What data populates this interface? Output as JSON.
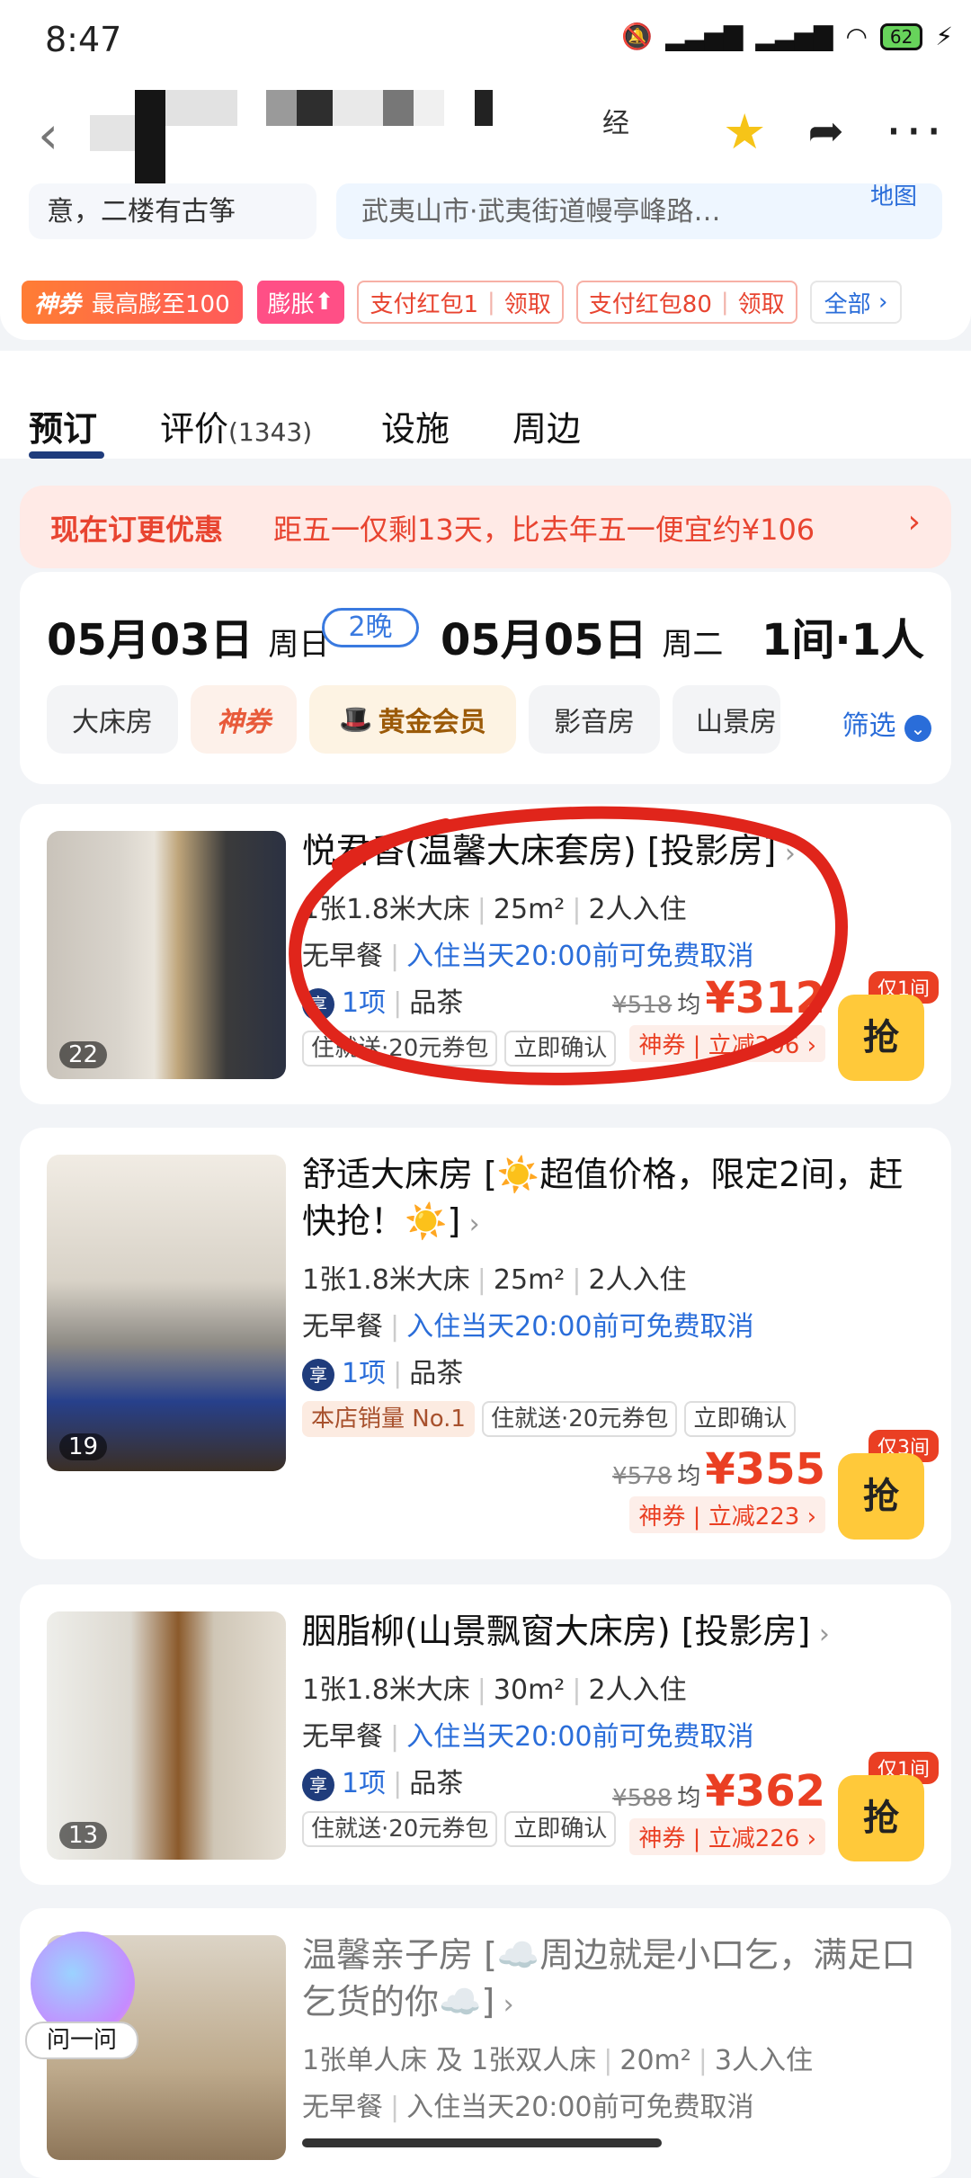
{
  "status_bar": {
    "time": "8:47",
    "battery": "62"
  },
  "header": {
    "title_visible_tail": "经"
  },
  "info": {
    "tip_text": "意，二楼有古筝",
    "address": "武夷山市·武夷街道幔亭峰路…",
    "map_label": "地图"
  },
  "coupons": {
    "god_tag": "神券",
    "god_text": "最高膨至100",
    "swell": "膨胀",
    "pay1_text": "支付红包1",
    "pay1_action": "领取",
    "pay2_text": "支付红包80",
    "pay2_action": "领取",
    "all": "全部"
  },
  "tabs": [
    {
      "label": "预订"
    },
    {
      "label": "评价",
      "count": "(1343)"
    },
    {
      "label": "设施"
    },
    {
      "label": "周边"
    }
  ],
  "promo": {
    "left": "现在订更优惠",
    "right": "距五一仅剩13天，比去年五一便宜约¥106"
  },
  "search": {
    "checkin_date": "05月03日",
    "checkin_weekday": "周日",
    "nights": "2晚",
    "checkout_date": "05月05日",
    "checkout_weekday": "周二",
    "guests": "1间·1人",
    "filters": [
      "大床房",
      "神券",
      "黄金会员",
      "影音房",
      "山景房"
    ],
    "filter_button": "筛选"
  },
  "rooms": [
    {
      "title": "悦君香(温馨大床套房) [投影房]",
      "bed": "1张1.8米大床",
      "area": "25m²",
      "occupancy": "2人入住",
      "breakfast": "无早餐",
      "cancel": "入住当天20:00前可免费取消",
      "perk_count": "1项",
      "perk_item": "品茶",
      "tags": [
        "住就送·20元券包",
        "立即确认"
      ],
      "old_price": "¥518",
      "avg_label": "均",
      "price": "¥312",
      "coupon_label": "神券",
      "discount": "立减206",
      "remaining": "仅1间",
      "grab": "抢",
      "image_count": "22"
    },
    {
      "title": "舒适大床房 [☀️超值价格，限定2间，赶快抢！☀️]",
      "bed": "1张1.8米大床",
      "area": "25m²",
      "occupancy": "2人入住",
      "breakfast": "无早餐",
      "cancel": "入住当天20:00前可免费取消",
      "perk_count": "1项",
      "perk_item": "品茶",
      "sales_tag": "本店销量 No.1",
      "tags": [
        "住就送·20元券包",
        "立即确认"
      ],
      "old_price": "¥578",
      "avg_label": "均",
      "price": "¥355",
      "coupon_label": "神券",
      "discount": "立减223",
      "remaining": "仅3间",
      "grab": "抢",
      "image_count": "19"
    },
    {
      "title": "胭脂柳(山景飘窗大床房) [投影房]",
      "bed": "1张1.8米大床",
      "area": "30m²",
      "occupancy": "2人入住",
      "breakfast": "无早餐",
      "cancel": "入住当天20:00前可免费取消",
      "perk_count": "1项",
      "perk_item": "品茶",
      "tags": [
        "住就送·20元券包",
        "立即确认"
      ],
      "old_price": "¥588",
      "avg_label": "均",
      "price": "¥362",
      "coupon_label": "神券",
      "discount": "立减226",
      "remaining": "仅1间",
      "grab": "抢",
      "image_count": "13"
    },
    {
      "title": "温馨亲子房 [☁️周边就是小口乞，满足口乞货的你☁️]",
      "bed": "1张单人床 及 1张双人床",
      "area": "20m²",
      "occupancy": "3人入住",
      "breakfast": "无早餐",
      "cancel": "入住当天20:00前可免费取消"
    }
  ],
  "assistant": {
    "label": "问一问"
  },
  "perk_badge": "享",
  "colors": {
    "accent_red": "#ea3f23",
    "link_blue": "#2a6dd9",
    "grab_yellow": "#ffc93a"
  }
}
